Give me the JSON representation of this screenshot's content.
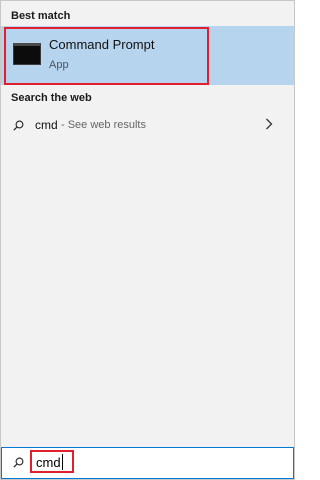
{
  "best_match": {
    "header": "Best match",
    "app_title": "Command Prompt",
    "app_subtitle": "App"
  },
  "web_search": {
    "header": "Search the web",
    "query": "cmd",
    "suffix": "- See web results"
  },
  "search_box": {
    "value": "cmd"
  },
  "icons": {
    "app": "command-prompt-icon",
    "web": "search-icon",
    "chevron": "chevron-right-icon",
    "bar": "search-icon"
  },
  "colors": {
    "selected_row": "#b7d4ee",
    "highlight_border": "#e0202e",
    "search_border": "#0078d4",
    "panel_bg": "#f2f2f2"
  }
}
